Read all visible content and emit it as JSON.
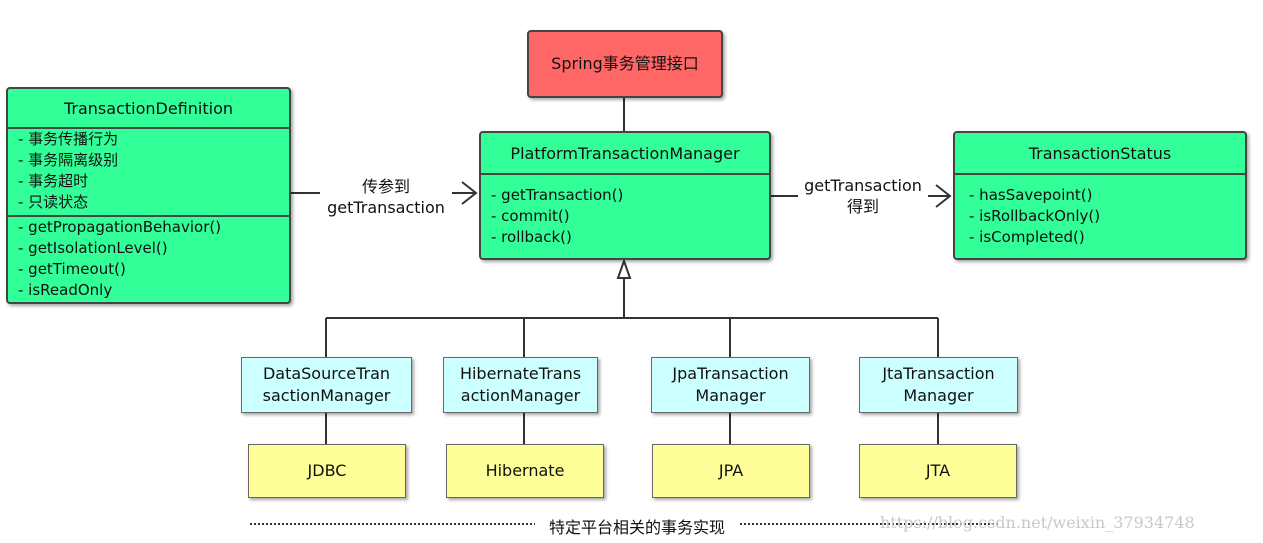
{
  "interface_label": "Spring事务管理接口",
  "definition": {
    "title": "TransactionDefinition",
    "attributes": [
      "- 事务传播行为",
      "- 事务隔离级别",
      "- 事务超时",
      "- 只读状态"
    ],
    "methods": [
      "- getPropagationBehavior()",
      "- getIsolationLevel()",
      "- getTimeout()",
      "- isReadOnly"
    ]
  },
  "manager": {
    "title": "PlatformTransactionManager",
    "methods": [
      "- getTransaction()",
      "- commit()",
      "- rollback()"
    ]
  },
  "status": {
    "title": "TransactionStatus",
    "methods": [
      "- hasSavepoint()",
      "- isRollbackOnly()",
      "- isCompleted()"
    ]
  },
  "arrow_left_label": [
    "传参到",
    "getTransaction"
  ],
  "arrow_right_label": [
    "getTransaction",
    "得到"
  ],
  "implementations": [
    {
      "line1": "DataSourceTran",
      "line2": "sactionManager",
      "platform": "JDBC"
    },
    {
      "line1": "HibernateTrans",
      "line2": "actionManager",
      "platform": "Hibernate"
    },
    {
      "line1": "JpaTransaction",
      "line2": "Manager",
      "platform": "JPA"
    },
    {
      "line1": "JtaTransaction",
      "line2": "Manager",
      "platform": "JTA"
    }
  ],
  "footer_label": "特定平台相关的事务实现",
  "watermark": "https://blog.csdn.net/weixin_37934748",
  "colors": {
    "interface": "#ff6666",
    "class": "#33ff99",
    "implementation": "#ccffff",
    "platform": "#ffff99"
  }
}
